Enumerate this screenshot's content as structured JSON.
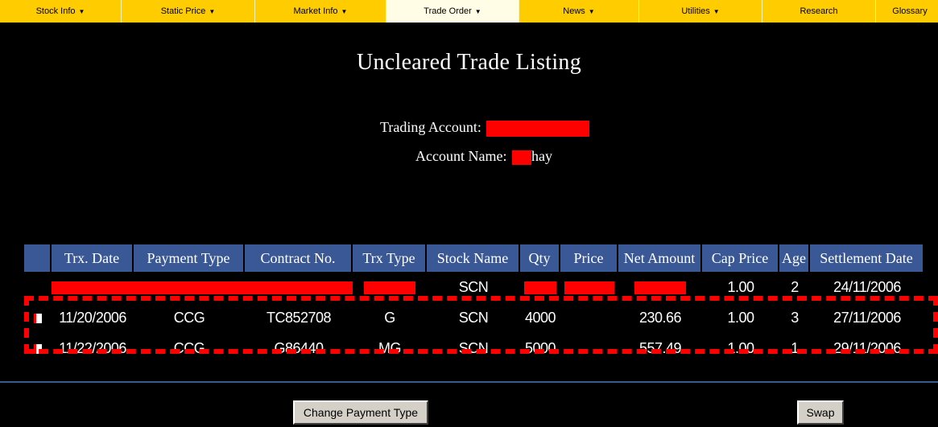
{
  "menu": {
    "items": [
      {
        "label": "Stock Info",
        "caret": true
      },
      {
        "label": "Static Price",
        "caret": true
      },
      {
        "label": "Market Info",
        "caret": true
      },
      {
        "label": "Trade Order",
        "caret": true
      },
      {
        "label": "News",
        "caret": true
      },
      {
        "label": "Utilities",
        "caret": true
      },
      {
        "label": "Research",
        "caret": false
      },
      {
        "label": "Glossary",
        "caret": false
      }
    ],
    "caret_glyph": "▼",
    "active_index": 3
  },
  "page": {
    "title": "Uncleared Trade Listing",
    "account_label": "Trading Account:",
    "account_name_label": "Account Name:",
    "account_name_visible": "hay"
  },
  "table": {
    "columns": [
      "Trx. Date",
      "Payment Type",
      "Contract No.",
      "Trx Type",
      "Stock Name",
      "Qty",
      "Price",
      "Net Amount",
      "Cap Price",
      "Age",
      "Settlement Date"
    ],
    "rows": [
      {
        "date": "",
        "payment": "",
        "contract": "",
        "trx_type": "",
        "stock": "SCN",
        "qty": "",
        "price": "",
        "net": "",
        "cap": "1.00",
        "age": "2",
        "settlement": "24/11/2006",
        "redacted": true
      },
      {
        "date": "11/20/2006",
        "payment": "CCG",
        "contract": "TC852708",
        "trx_type": "G",
        "stock": "SCN",
        "qty": "4000",
        "price": "",
        "net": "230.66",
        "cap": "1.00",
        "age": "3",
        "settlement": "27/11/2006",
        "redacted": false
      },
      {
        "date": "11/22/2006",
        "payment": "CCG",
        "contract": "G86440",
        "trx_type": "MG",
        "stock": "SCN",
        "qty": "5000",
        "price": "",
        "net": "557.49",
        "cap": "1.00",
        "age": "1",
        "settlement": "29/11/2006",
        "redacted": false
      }
    ]
  },
  "buttons": {
    "change_payment": "Change Payment Type",
    "swap": "Swap"
  },
  "colors": {
    "menu_bg": "#ffcc00",
    "header_bg": "#3a5896",
    "redaction": "#ff0000"
  }
}
